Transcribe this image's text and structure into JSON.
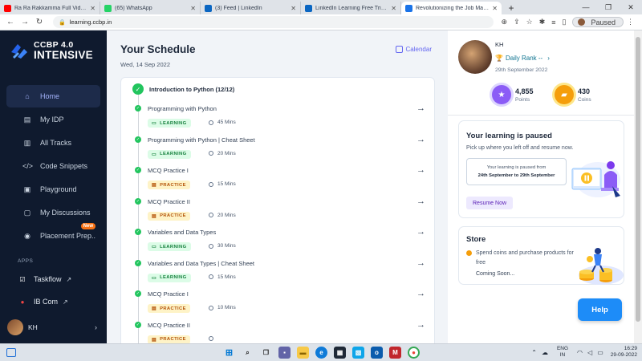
{
  "browser": {
    "tabs": [
      {
        "title": "Ra Ra Rakkamma Full Video Song",
        "fav_color": "#ff0000",
        "active": false
      },
      {
        "title": "(65) WhatsApp",
        "fav_color": "#25d366",
        "active": false
      },
      {
        "title": "(3) Feed | LinkedIn",
        "fav_color": "#0a66c2",
        "active": false
      },
      {
        "title": "LinkedIn Learning Free Trial and",
        "fav_color": "#0a66c2",
        "active": false
      },
      {
        "title": "Revolutionizing the Job Market |",
        "fav_color": "#1a73e8",
        "active": true
      }
    ],
    "url": "learning.ccbp.in",
    "profile_status": "Paused"
  },
  "sidebar": {
    "logo_line1": "CCBP 4.0",
    "logo_line2": "INTENSIVE",
    "nav": [
      {
        "label": "Home",
        "icon": "home-icon",
        "glyph": "⌂",
        "active": true
      },
      {
        "label": "My IDP",
        "icon": "document-icon",
        "glyph": "▤",
        "active": false
      },
      {
        "label": "All Tracks",
        "icon": "book-icon",
        "glyph": "▥",
        "active": false
      },
      {
        "label": "Code Snippets",
        "icon": "code-icon",
        "glyph": "</>",
        "active": false
      },
      {
        "label": "Playground",
        "icon": "terminal-icon",
        "glyph": "▣",
        "active": false
      },
      {
        "label": "My Discussions",
        "icon": "chat-icon",
        "glyph": "▢",
        "active": false
      },
      {
        "label": "Placement Prep..",
        "icon": "briefcase-icon",
        "glyph": "◉",
        "active": false,
        "badge": "New"
      }
    ],
    "apps_label": "APPS",
    "apps": [
      {
        "label": "Taskflow",
        "icon": "taskflow-icon",
        "color": "#ffffff"
      },
      {
        "label": "IB Com",
        "icon": "ibcom-icon",
        "color": "#ef4444"
      }
    ],
    "user_initials": "KH"
  },
  "schedule": {
    "title": "Your Schedule",
    "date": "Wed, 14 Sep 2022",
    "calendar_label": "Calendar",
    "module_title": "Introduction to Python (12/12)",
    "items": [
      {
        "title": "Programming with Python",
        "type": "LEARNING",
        "duration": "45 Mins"
      },
      {
        "title": "Programming with Python | Cheat Sheet",
        "type": "LEARNING",
        "duration": "20 Mins"
      },
      {
        "title": "MCQ Practice I",
        "type": "PRACTICE",
        "duration": "15 Mins"
      },
      {
        "title": "MCQ Practice II",
        "type": "PRACTICE",
        "duration": "20 Mins"
      },
      {
        "title": "Variables and Data Types",
        "type": "LEARNING",
        "duration": "30 Mins"
      },
      {
        "title": "Variables and Data Types | Cheat Sheet",
        "type": "LEARNING",
        "duration": "15 Mins"
      },
      {
        "title": "MCQ Practice I",
        "type": "PRACTICE",
        "duration": "10 Mins"
      },
      {
        "title": "MCQ Practice II",
        "type": "PRACTICE",
        "duration": ""
      }
    ]
  },
  "profile": {
    "name": "KH",
    "rank_label": "Daily Rank --",
    "date": "29th September 2022",
    "points_value": "4,855",
    "points_label": "Points",
    "coins_value": "430",
    "coins_label": "Coins"
  },
  "paused_card": {
    "title": "Your learning is paused",
    "subtitle": "Pick up where you left off and resume now.",
    "box_line1": "Your learning is paused from",
    "box_line2": "24th September to 29th September",
    "button": "Resume Now"
  },
  "store_card": {
    "title": "Store",
    "description": "Spend coins and purchase products for free",
    "coming_soon": "Coming Soon..."
  },
  "help_label": "Help",
  "taskbar": {
    "lang_line1": "ENG",
    "lang_line2": "IN",
    "time": "16:29",
    "date": "29-09-2022"
  }
}
